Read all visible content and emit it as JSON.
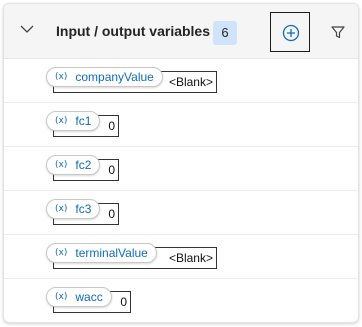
{
  "header": {
    "title": "Input / output variables",
    "count": "6",
    "add_icon": "circle-plus-icon",
    "filter_icon": "filter-funnel-icon",
    "collapse_icon": "chevron-down-icon"
  },
  "variables": [
    {
      "icon": "(x)",
      "name": "companyValue",
      "value": "<Blank>"
    },
    {
      "icon": "(x)",
      "name": "fc1",
      "value": "0"
    },
    {
      "icon": "(x)",
      "name": "fc2",
      "value": "0"
    },
    {
      "icon": "(x)",
      "name": "fc3",
      "value": "0"
    },
    {
      "icon": "(x)",
      "name": "terminalValue",
      "value": "<Blank>"
    },
    {
      "icon": "(x)",
      "name": "wacc",
      "value": "0"
    }
  ],
  "colors": {
    "accent": "#0f6cbd",
    "badge_bg": "#cfe4fa",
    "header_bg": "#f5f5f5"
  }
}
